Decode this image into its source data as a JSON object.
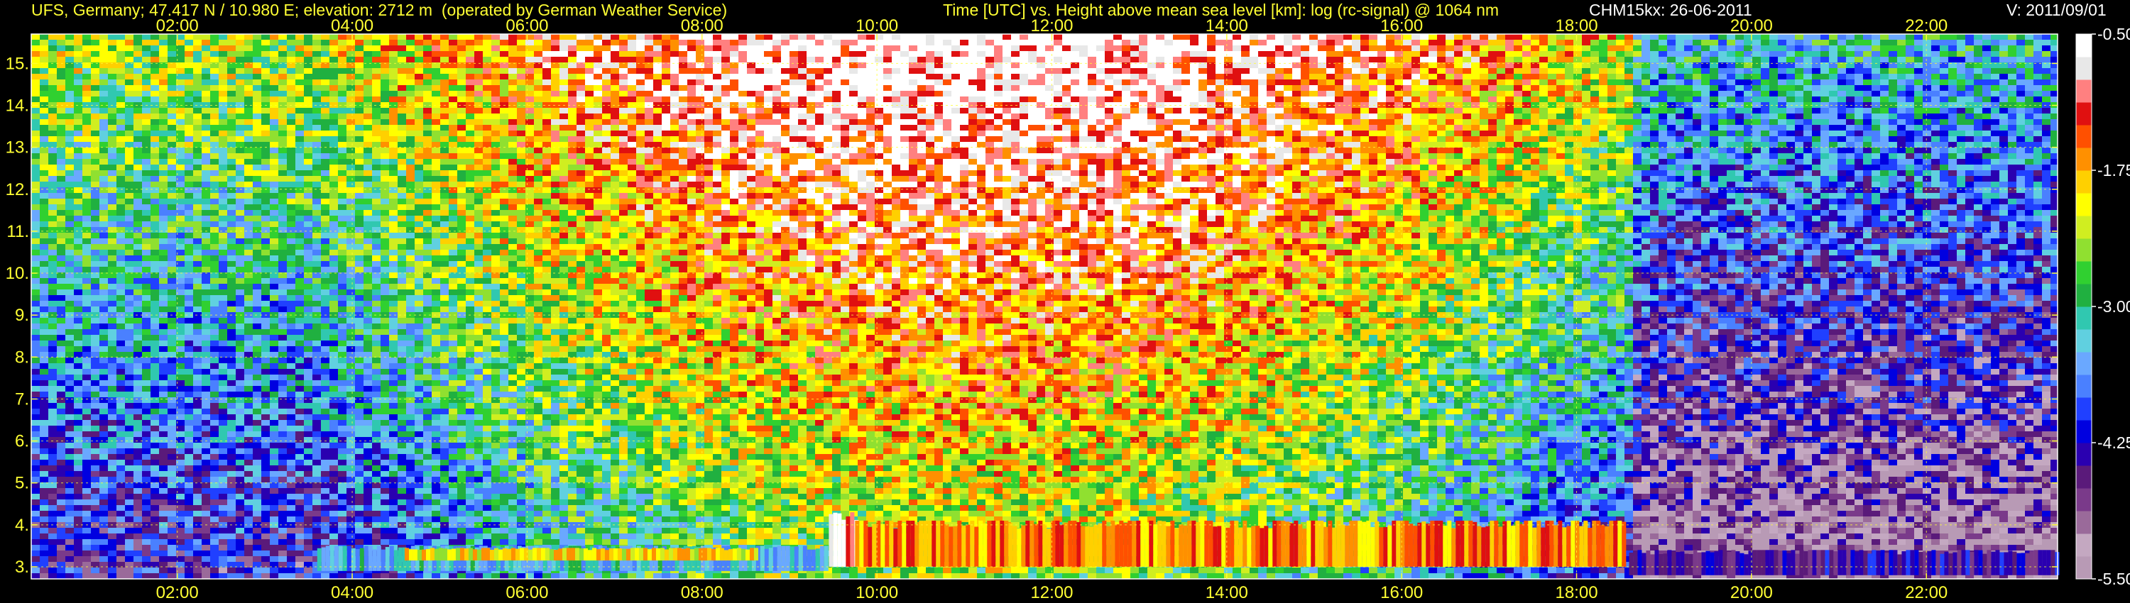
{
  "header": {
    "station": "UFS, Germany; 47.417 N / 10.980 E; elevation: 2712 m  (operated by German Weather Service)",
    "description": "Time [UTC] vs. Height above mean sea level [km]: log (rc-signal) @ 1064 nm",
    "instrument_date": "CHM15kx: 26-06-2011",
    "version": "V: 2011/09/01"
  },
  "colors": {
    "background": "#000000",
    "header_text": "#ffff33",
    "grid": "#ffff33",
    "colorbar_label": "#ffffff"
  },
  "chart_data": {
    "type": "heatmap",
    "title": "Time [UTC] vs. Height above mean sea level [km]: log (rc-signal) @ 1064 nm",
    "x_unit": "hour UTC",
    "y_unit": "km",
    "xlim": [
      0.33,
      23.5
    ],
    "ylim": [
      2.712,
      15.7
    ],
    "x_ticks": [
      2,
      4,
      6,
      8,
      10,
      12,
      14,
      16,
      18,
      20,
      22
    ],
    "x_tick_labels": [
      "02:00",
      "04:00",
      "06:00",
      "08:00",
      "10:00",
      "12:00",
      "14:00",
      "16:00",
      "18:00",
      "20:00",
      "22:00"
    ],
    "y_ticks": [
      3,
      4,
      5,
      6,
      7,
      8,
      9,
      10,
      11,
      12,
      13,
      14,
      15
    ],
    "y_tick_labels": [
      "3.",
      "4.",
      "5.",
      "6.",
      "7.",
      "8.",
      "9.",
      "10.",
      "11.",
      "12.",
      "13.",
      "14.",
      "15."
    ],
    "grid": true,
    "colorbar": {
      "vmin": -5.5,
      "vmax": -0.5,
      "ticks": [
        -0.5,
        -1.75,
        -3.0,
        -4.25,
        -5.5
      ],
      "tick_labels": [
        "-0.50",
        "-1.75",
        "-3.00",
        "-4.25",
        "-5.50"
      ],
      "colors": [
        "#b89ab5",
        "#c4a8c1",
        "#9a6a9a",
        "#7a3a8a",
        "#5a1a7a",
        "#2a00b0",
        "#0000e0",
        "#2040ff",
        "#4a80ff",
        "#6aa8ff",
        "#60d0e0",
        "#30c8b0",
        "#20b040",
        "#30d030",
        "#90e030",
        "#d0ee20",
        "#ffff00",
        "#ffd000",
        "#ff9000",
        "#ff5000",
        "#e01010",
        "#ff8080",
        "#e8e8e8",
        "#ffffff"
      ]
    },
    "features": [
      {
        "name": "noise_background",
        "start": 0.33,
        "end": 23.5,
        "level": -1.7
      },
      {
        "name": "boundary_layer_morning",
        "start": 3.6,
        "end": 9.4,
        "base": 2.9,
        "top": 3.5,
        "level": -3.4
      },
      {
        "name": "aerosol_layer_morning",
        "start": 4.6,
        "end": 8.6,
        "base": 3.15,
        "top": 3.45,
        "level": -2.0
      },
      {
        "name": "cloud_onset",
        "start": 9.45,
        "end": 9.75,
        "base": 3.0,
        "top": 4.3,
        "level": -0.7
      },
      {
        "name": "convective_boundary_layer",
        "start": 9.75,
        "end": 18.55,
        "base": 3.0,
        "top": 4.1,
        "level": -1.6
      },
      {
        "name": "evening_residual_layer",
        "start": 18.6,
        "end": 23.5,
        "base": 2.8,
        "top": 3.4,
        "level": -4.4
      }
    ]
  }
}
